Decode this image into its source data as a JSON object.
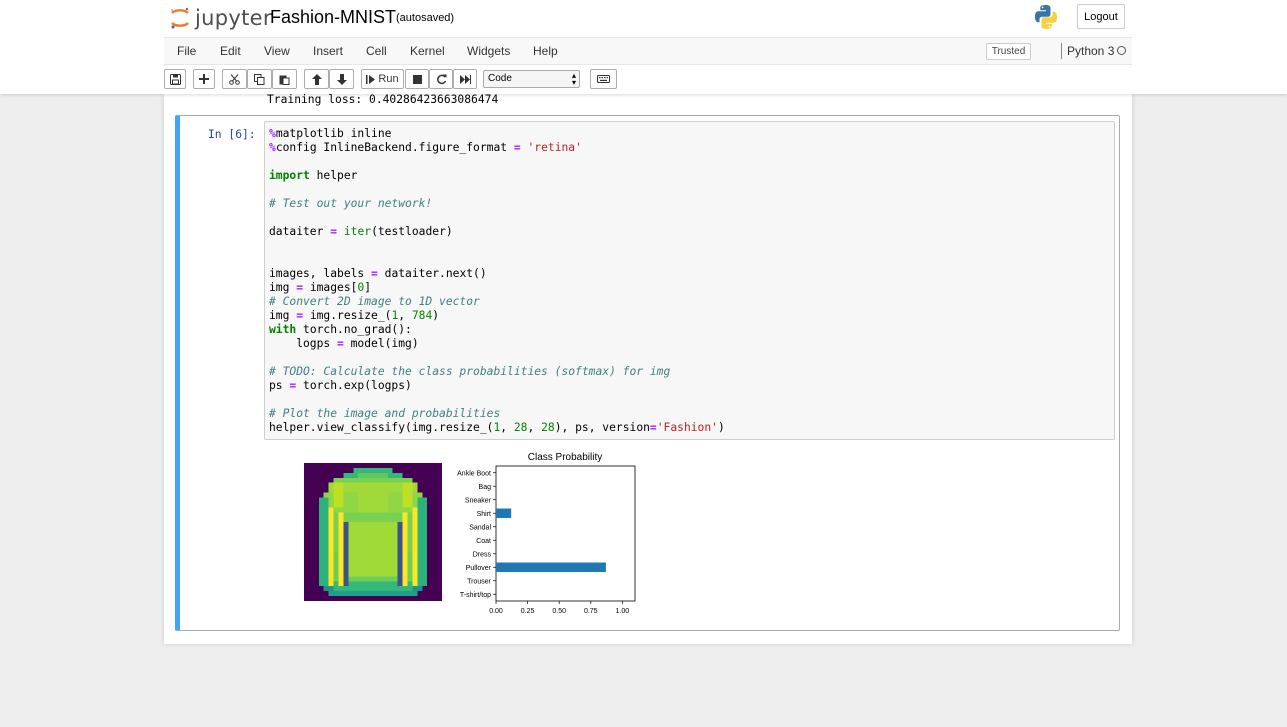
{
  "header": {
    "logo_text": "jupyter",
    "notebook_title": "Fashion-MNIST",
    "autosave": "(autosaved)",
    "logout_label": "Logout"
  },
  "menubar": {
    "items": [
      "File",
      "Edit",
      "View",
      "Insert",
      "Cell",
      "Kernel",
      "Widgets",
      "Help"
    ],
    "trusted_label": "Trusted",
    "kernel_name": "Python 3"
  },
  "toolbar": {
    "run_label": "Run",
    "cell_type": "Code",
    "icons": [
      "save-icon",
      "plus-icon",
      "cut-icon",
      "copy-icon",
      "paste-icon",
      "arrow-up-icon",
      "arrow-down-icon",
      "run-icon",
      "stop-icon",
      "restart-icon",
      "fast-forward-icon",
      "keyboard-icon"
    ]
  },
  "notebook": {
    "previous_output": "Training loss: 0.40286423663086474",
    "cell": {
      "prompt": "In [6]:",
      "code_lines": [
        "%matplotlib inline",
        "%config InlineBackend.figure_format = 'retina'",
        "",
        "import helper",
        "",
        "# Test out your network!",
        "",
        "dataiter = iter(testloader)",
        "",
        "",
        "images, labels = dataiter.next()",
        "img = images[0]",
        "# Convert 2D image to 1D vector",
        "img = img.resize_(1, 784)",
        "with torch.no_grad():",
        "    logps = model(img)",
        "",
        "# TODO: Calculate the class probabilities (softmax) for img",
        "ps = torch.exp(logps)",
        "",
        "# Plot the image and probabilities",
        "helper.view_classify(img.resize_(1, 28, 28), ps, version='Fashion')"
      ]
    }
  },
  "colors": {
    "cell_selected_border": "#42a5f5",
    "bar_color": "#1f77b4",
    "image_background": "#440154",
    "image_foreground": "#7ad151"
  },
  "chart_data": {
    "type": "bar",
    "orientation": "horizontal",
    "title": "Class Probability",
    "categories": [
      "T-shirt/top",
      "Trouser",
      "Pullover",
      "Dress",
      "Coat",
      "Sandal",
      "Shirt",
      "Sneaker",
      "Bag",
      "Ankle Boot"
    ],
    "values": [
      0.0,
      0.0,
      0.87,
      0.0,
      0.0,
      0.0,
      0.12,
      0.0,
      0.0,
      0.0
    ],
    "xlim": [
      0,
      1.1
    ],
    "xticks": [
      "0.00",
      "0.25",
      "0.50",
      "0.75",
      "1.00"
    ],
    "xtick_values": [
      0,
      0.25,
      0.5,
      0.75,
      1.0
    ],
    "xlabel": "",
    "ylabel": "",
    "grid": false
  }
}
